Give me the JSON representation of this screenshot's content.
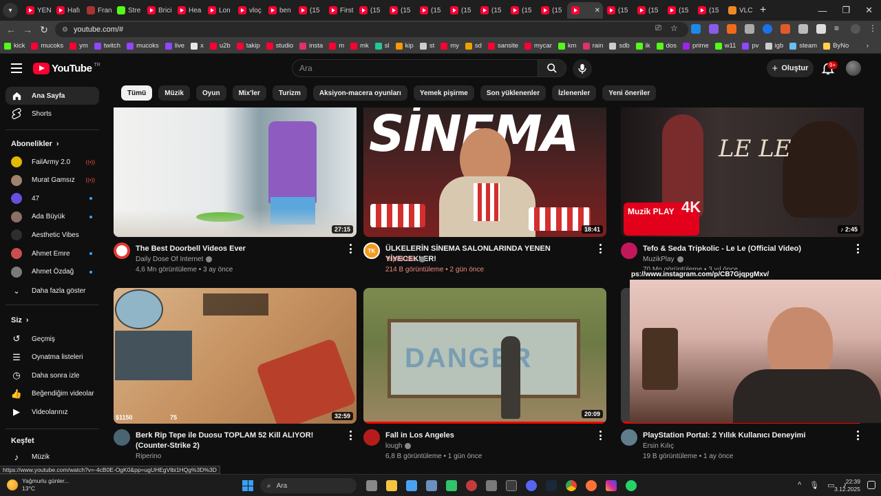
{
  "browser": {
    "tabs": [
      {
        "label": "YEN",
        "icon": "youtube-icon"
      },
      {
        "label": "Hafı",
        "icon": "youtube-icon"
      },
      {
        "label": "Fran",
        "icon": "opera-icon"
      },
      {
        "label": "Stre",
        "icon": "kick-icon"
      },
      {
        "label": "Brici",
        "icon": "youtube-icon"
      },
      {
        "label": "Hea",
        "icon": "youtube-icon"
      },
      {
        "label": "Lon",
        "icon": "youtube-icon"
      },
      {
        "label": "vloç",
        "icon": "youtube-icon"
      },
      {
        "label": "ben",
        "icon": "youtube-icon"
      },
      {
        "label": "(15",
        "icon": "youtube-icon"
      },
      {
        "label": "First",
        "icon": "youtube-icon"
      },
      {
        "label": "(15",
        "icon": "youtube-icon"
      },
      {
        "label": "(15",
        "icon": "youtube-icon"
      },
      {
        "label": "(15",
        "icon": "youtube-icon"
      },
      {
        "label": "(15",
        "icon": "youtube-icon"
      },
      {
        "label": "(15",
        "icon": "youtube-icon"
      },
      {
        "label": "(15",
        "icon": "youtube-icon"
      },
      {
        "label": "(15",
        "icon": "youtube-icon"
      },
      {
        "label": "",
        "icon": "youtube-icon",
        "active": true
      },
      {
        "label": "(15",
        "icon": "youtube-icon"
      },
      {
        "label": "(15",
        "icon": "youtube-icon"
      },
      {
        "label": "(15",
        "icon": "youtube-icon"
      },
      {
        "label": "(15",
        "icon": "youtube-icon"
      },
      {
        "label": "VLC",
        "icon": "vlc-icon"
      }
    ],
    "url": "youtube.com/#",
    "bookmarks": [
      {
        "label": "kick",
        "color": "#53fc18"
      },
      {
        "label": "mucoks",
        "color": "#ff0033"
      },
      {
        "label": "ym",
        "color": "#ff0033"
      },
      {
        "label": "twitch",
        "color": "#9146ff"
      },
      {
        "label": "mucoks",
        "color": "#9146ff"
      },
      {
        "label": "live",
        "color": "#9146ff"
      },
      {
        "label": "x",
        "color": "#e7e7e7"
      },
      {
        "label": "u2b",
        "color": "#ff0033"
      },
      {
        "label": "takip",
        "color": "#ff0033"
      },
      {
        "label": "studio",
        "color": "#ff0033"
      },
      {
        "label": "insta",
        "color": "#e1306c"
      },
      {
        "label": "m",
        "color": "#ff0033"
      },
      {
        "label": "mk",
        "color": "#ff0033"
      },
      {
        "label": "sl",
        "color": "#20c997"
      },
      {
        "label": "kip",
        "color": "#ff9900"
      },
      {
        "label": "st",
        "color": "#cccccc"
      },
      {
        "label": "my",
        "color": "#ff0033"
      },
      {
        "label": "sd",
        "color": "#f0a000"
      },
      {
        "label": "sansite",
        "color": "#ff0033"
      },
      {
        "label": "mycar",
        "color": "#ff0033"
      },
      {
        "label": "km",
        "color": "#53fc18"
      },
      {
        "label": "rain",
        "color": "#e1306c"
      },
      {
        "label": "sdb",
        "color": "#cccccc"
      },
      {
        "label": "ik",
        "color": "#53fc18"
      },
      {
        "label": "dos",
        "color": "#53fc18"
      },
      {
        "label": "prime",
        "color": "#a020f0"
      },
      {
        "label": "w11",
        "color": "#53fc18"
      },
      {
        "label": "pv",
        "color": "#9146ff"
      },
      {
        "label": "igb",
        "color": "#cccccc"
      },
      {
        "label": "steam",
        "color": "#66c0f4"
      },
      {
        "label": "ByNo",
        "color": "#ffd24a"
      }
    ],
    "status_url": "https://www.youtube.com/watch?v=-4cB0E-OgK0&pp=ugUHEgVlbi1HQg%3D%3D"
  },
  "header": {
    "logo_text": "YouTube",
    "logo_region": "TR",
    "search_placeholder": "Ara",
    "create_label": "Oluştur",
    "notif_badge": "9+"
  },
  "chips": [
    "Tümü",
    "Müzik",
    "Oyun",
    "Mix'ler",
    "Turizm",
    "Aksiyon-macera oyunları",
    "Yemek pişirme",
    "Son yüklenenler",
    "İzlenenler",
    "Yeni öneriler"
  ],
  "sidebar": {
    "home": "Ana Sayfa",
    "shorts": "Shorts",
    "subs_header": "Abonelikler",
    "subscriptions": [
      {
        "name": "FailArmy 2.0",
        "status": "live",
        "color": "#e2b800"
      },
      {
        "name": "Murat Gamsız",
        "status": "live",
        "color": "#a0826d"
      },
      {
        "name": "47",
        "status": "dot",
        "color": "#6a4ee0"
      },
      {
        "name": "Ada Büyük",
        "status": "dot",
        "color": "#8d6e63"
      },
      {
        "name": "Aesthetic Vibes",
        "status": "none",
        "color": "#2e2e2e"
      },
      {
        "name": "Ahmet Emre",
        "status": "dot",
        "color": "#c94f4f"
      },
      {
        "name": "Ahmet Özdağ",
        "status": "dot",
        "color": "#7a7a7a"
      }
    ],
    "show_more": "Daha fazla göster",
    "you_header": "Siz",
    "you_items": [
      "Geçmiş",
      "Oynatma listeleri",
      "Daha sonra izle",
      "Beğendiğim videolar",
      "Videolarınız"
    ],
    "explore_header": "Keşfet",
    "explore_items": [
      "Müzik"
    ]
  },
  "videos": [
    {
      "title": "The Best Doorbell Videos Ever",
      "channel": "Daily Dose Of Internet",
      "stats": "4,6 Mn görüntüleme • 3 ay önce",
      "duration": "27:15",
      "avatar_color": "#e53935",
      "verified": true
    },
    {
      "title": "ÜLKELERİN SİNEMA SALONLARINDA YENEN YİYECEKLER!",
      "channel": "TepkiKolik",
      "stats": "214 B görüntüleme • 2 gün önce",
      "duration": "18:41",
      "avatar_color": "#f29c1f",
      "verified": true,
      "thumb_text": "SİNEMA",
      "highlight": true
    },
    {
      "title": "Tefo & Seda Tripkolic - Le Le (Official Video)",
      "channel": "MuzikPlay",
      "stats": "70 Mn görüntüleme • 3 yıl önce",
      "duration": "2:45",
      "avatar_color": "#c2185b",
      "verified": true,
      "thumb_text": "LE LE",
      "thumb_badge": "Muzik PLAY",
      "thumb_badge2": "4K"
    },
    {
      "title": "Berk Rip Tepe ile Duosu TOPLAM 52 Kill ALIYOR! (Counter-Strike 2)",
      "channel": "Riperino",
      "stats": "",
      "duration": "32:59",
      "avatar_color": "#4a6572",
      "verified": false,
      "hud_money": "$1150",
      "hud_ammo": "75"
    },
    {
      "title": "Fall in Los Angeles",
      "channel": "lough",
      "stats": "6,8 B görüntüleme • 1 gün önce",
      "duration": "20:09",
      "avatar_color": "#b71c1c",
      "verified": true
    },
    {
      "title": "PlayStation Portal: 2 Yıllık Kullanıcı Deneyimi",
      "channel": "Ersin Kılıç",
      "stats": "19 B görüntüleme • 1 ay önce",
      "duration": "",
      "avatar_color": "#607d8b",
      "verified": false
    }
  ],
  "overlay_text": "ps://www.instagram.com/p/CB7GjqpgMxv/",
  "taskbar": {
    "weather_text": "Yağmurlu günler...",
    "weather_temp": "13°C",
    "search_label": "Ara",
    "time": "22:39",
    "date": "3.12.2025"
  }
}
